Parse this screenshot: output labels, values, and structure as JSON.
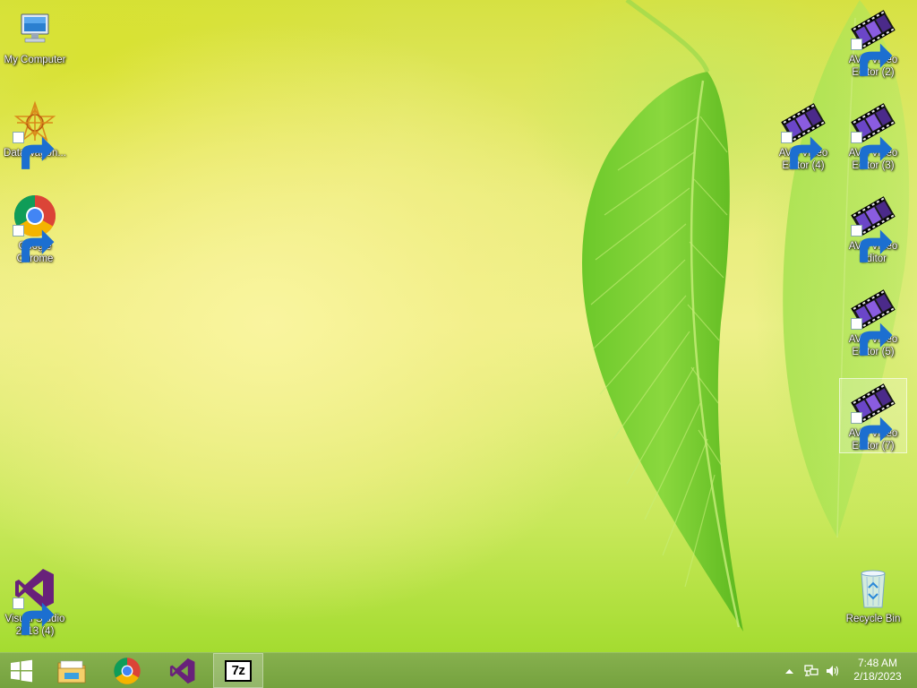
{
  "desktop": {
    "icons_left": [
      {
        "label": "My Computer",
        "icon": "computer-icon"
      },
      {
        "label": "DataWagon...",
        "icon": "datawagon-icon"
      },
      {
        "label": "Google Chrome",
        "icon": "chrome-icon"
      },
      {
        "label": "Visual Studio 2013 (4)",
        "icon": "visual-studio-icon"
      }
    ],
    "icons_right": [
      {
        "label": "AVS Video Editor (2)",
        "icon": "avs-video-editor-icon"
      },
      {
        "label": "AVS Video Editor (4)",
        "icon": "avs-video-editor-icon"
      },
      {
        "label": "AVS Video Editor (3)",
        "icon": "avs-video-editor-icon"
      },
      {
        "label": "AVS Video Editor",
        "icon": "avs-video-editor-icon"
      },
      {
        "label": "AVS Video Editor (5)",
        "icon": "avs-video-editor-icon"
      },
      {
        "label": "AVS Video Editor (7)",
        "icon": "avs-video-editor-icon",
        "selected": true
      },
      {
        "label": "Recycle Bin",
        "icon": "recycle-bin-icon"
      }
    ]
  },
  "taskbar": {
    "start": {
      "icon": "windows-start-icon"
    },
    "pinned": [
      {
        "icon": "file-explorer-icon"
      },
      {
        "icon": "chrome-icon"
      },
      {
        "icon": "visual-studio-icon"
      },
      {
        "icon": "7zip-icon",
        "text": "7z",
        "active": true
      }
    ],
    "tray": {
      "icons": [
        "show-hidden-icons-chevron-icon",
        "network-icon",
        "volume-icon"
      ],
      "time": "7:48 AM",
      "date": "2/18/2023"
    }
  },
  "colors": {
    "taskbar": "#77a341",
    "wallpaper_top": "#d6e142",
    "wallpaper_bottom": "#a4dc30",
    "avs_purple": "#4b2a8a",
    "vs_purple": "#68217a"
  }
}
